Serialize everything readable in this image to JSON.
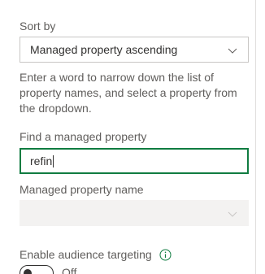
{
  "sort": {
    "label": "Sort by",
    "selected": "Managed property ascending"
  },
  "help_text": "Enter a word to narrow down the list of property names, and select a property from the dropdown.",
  "find": {
    "label": "Find a managed property",
    "value": "refin"
  },
  "property_name": {
    "label": "Managed property name",
    "selected": ""
  },
  "audience": {
    "label": "Enable audience targeting",
    "toggle_state": "Off"
  },
  "icons": {
    "dropdown": "chevron-down-icon",
    "info": "info-icon"
  },
  "colors": {
    "focus_border": "#107c41",
    "disabled_fill": "#f3f2f1",
    "info_accent": "#107c41"
  }
}
